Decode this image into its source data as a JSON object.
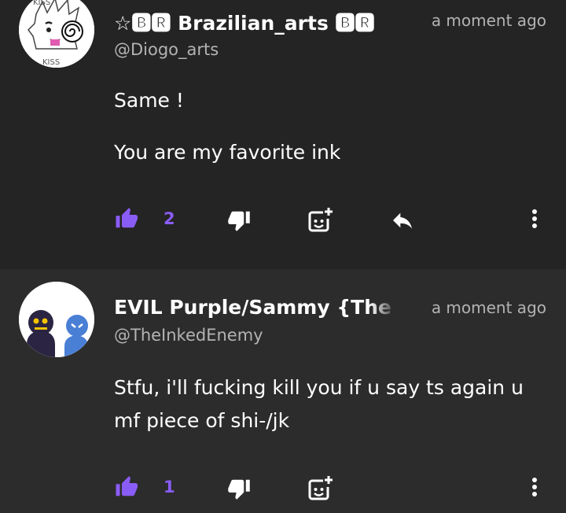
{
  "comments": [
    {
      "author_name": "☆🅱🆁 Brazilian_arts 🅱🆁",
      "handle": "@Diogo_arts",
      "time": "a moment ago",
      "avatar_text_top": "KISS",
      "avatar_text_bottom": "KISS",
      "paragraphs": [
        "Same !",
        "You are my favorite ink"
      ],
      "like_count": "2"
    },
    {
      "author_name": "EVIL Purple/Sammy {The",
      "handle": "@TheInkedEnemy",
      "time": "a moment ago",
      "paragraphs": [
        "Stfu, i'll fucking kill you if u say ts again u mf piece of shi-/jk"
      ],
      "like_count": "1"
    }
  ],
  "icons": {
    "like": "thumbs-up-icon",
    "dislike": "thumbs-down-icon",
    "react": "add-emoji-icon",
    "reply": "reply-arrow-icon",
    "more": "more-vertical-icon"
  },
  "colors": {
    "accent": "#8a5cf6",
    "background_1": "#242424",
    "background_2": "#2c2c2c",
    "muted_text": "#b3b3b3"
  }
}
